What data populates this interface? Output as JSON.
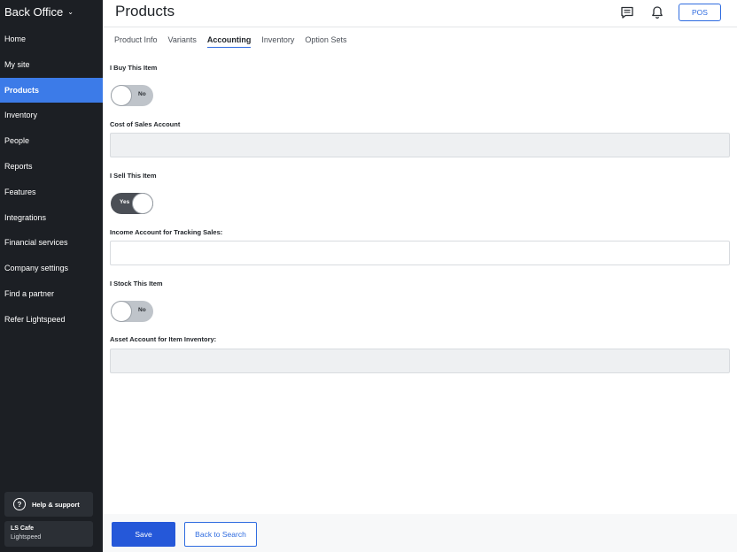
{
  "sidebar": {
    "brand": "Back Office",
    "items": [
      {
        "label": "Home"
      },
      {
        "label": "My site"
      },
      {
        "label": "Products",
        "active": true
      },
      {
        "label": "Inventory"
      },
      {
        "label": "People"
      },
      {
        "label": "Reports"
      },
      {
        "label": "Features"
      },
      {
        "label": "Integrations"
      },
      {
        "label": "Financial services"
      },
      {
        "label": "Company settings"
      },
      {
        "label": "Find a partner"
      },
      {
        "label": "Refer Lightspeed"
      }
    ],
    "help_label": "Help & support",
    "account": {
      "name": "LS Cafe",
      "org": "Lightspeed"
    }
  },
  "header": {
    "title": "Products",
    "pos_label": "POS",
    "icons": [
      "chat-icon",
      "bell-icon"
    ]
  },
  "tabs": [
    {
      "label": "Product Info"
    },
    {
      "label": "Variants"
    },
    {
      "label": "Accounting",
      "active": true
    },
    {
      "label": "Inventory"
    },
    {
      "label": "Option Sets"
    }
  ],
  "form": {
    "buy": {
      "label": "I Buy This Item",
      "toggle": "No"
    },
    "cost_account": {
      "label": "Cost of Sales Account",
      "value": ""
    },
    "sell": {
      "label": "I Sell This Item",
      "toggle": "Yes"
    },
    "income_account": {
      "label": "Income Account for Tracking Sales:",
      "value": ""
    },
    "stock": {
      "label": "I Stock This Item",
      "toggle": "No"
    },
    "asset_account": {
      "label": "Asset Account for Item Inventory:",
      "value": ""
    }
  },
  "footer": {
    "save_label": "Save",
    "back_label": "Back to Search"
  },
  "colors": {
    "sidebar_bg": "#1c1f24",
    "active_nav": "#3c7be8",
    "primary": "#2558d9",
    "accent": "#2f6ce0"
  }
}
